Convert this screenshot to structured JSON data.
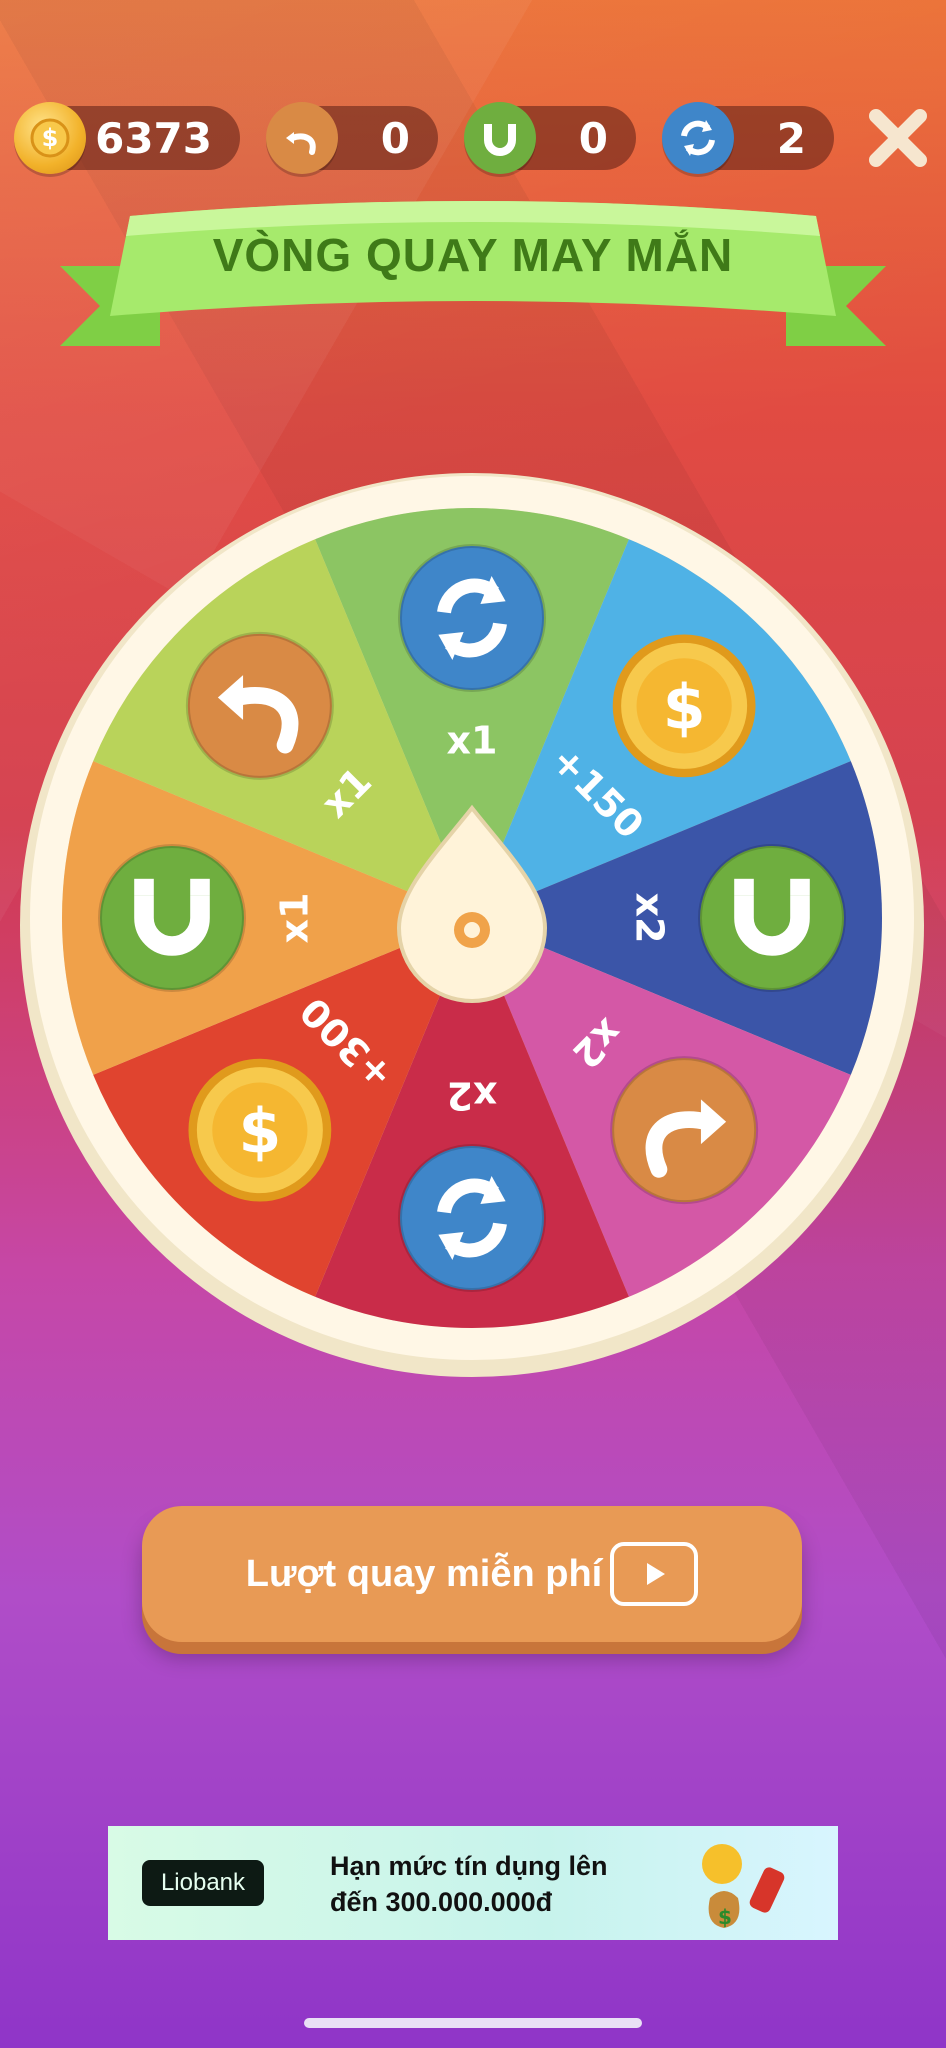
{
  "header": {
    "coins": "6373",
    "undo_count": "0",
    "magnet_count": "0",
    "shuffle_count": "2"
  },
  "title": "VÒNG QUAY MAY MẮN",
  "wheel": {
    "segments": [
      {
        "label": "x1",
        "icon": "shuffle-icon",
        "color": "#8cc563"
      },
      {
        "label": "+150",
        "icon": "coin-icon",
        "color": "#4fb2e6"
      },
      {
        "label": "x2",
        "icon": "magnet-icon",
        "color": "#3b55a8"
      },
      {
        "label": "x2",
        "icon": "redo-icon",
        "color": "#d458a6"
      },
      {
        "label": "x2",
        "icon": "shuffle-icon",
        "color": "#c92c49"
      },
      {
        "label": "+300",
        "icon": "coin-icon",
        "color": "#e0442f"
      },
      {
        "label": "x1",
        "icon": "magnet-icon",
        "color": "#f0a14a"
      },
      {
        "label": "x1",
        "icon": "undo-icon",
        "color": "#b9d35a"
      }
    ]
  },
  "spin": {
    "label": "Lượt quay miễn phí"
  },
  "ad": {
    "brand": "Liobank",
    "line1": "Hạn mức tín dụng lên",
    "line2": "đến 300.000.000đ"
  },
  "colors": {
    "coin": "#f5b731",
    "undo": "#d98a45",
    "magnet": "#6fae3f",
    "shuffle": "#3f86c9",
    "button": "#e89a55"
  }
}
